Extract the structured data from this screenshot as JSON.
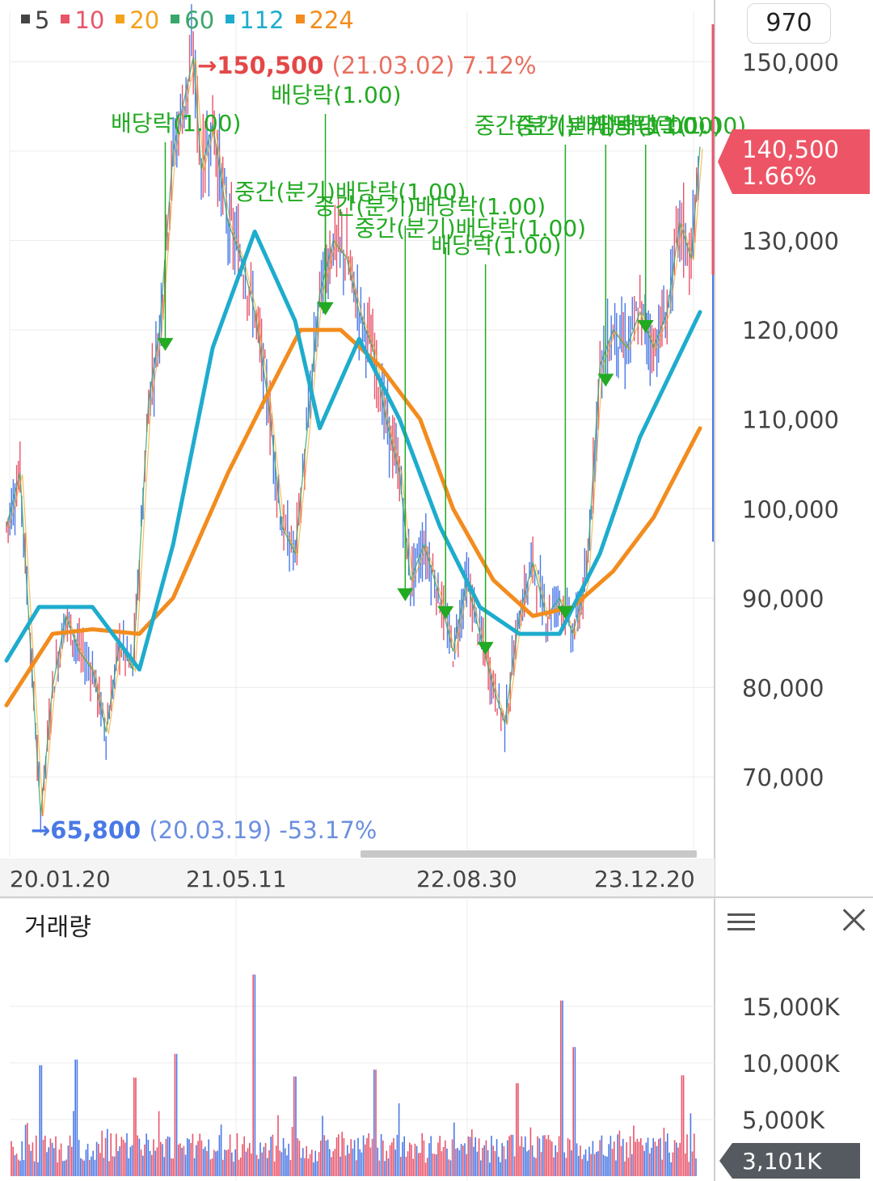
{
  "legend": [
    {
      "label": "5",
      "color": "#444444"
    },
    {
      "label": "10",
      "color": "#e8556b"
    },
    {
      "label": "20",
      "color": "#f4a21c"
    },
    {
      "label": "60",
      "color": "#3aa66a"
    },
    {
      "label": "112",
      "color": "#1eaccd"
    },
    {
      "label": "224",
      "color": "#f28c1e"
    }
  ],
  "ma_count": "970",
  "max_marker": {
    "price": "150,500",
    "detail": "(21.03.02) 7.12%"
  },
  "min_marker": {
    "price": "65,800",
    "detail": "(20.03.19) -53.17%"
  },
  "current": {
    "price": "140,500",
    "change": "1.66%"
  },
  "volume_title": "거래량",
  "volume_current": "3,101K",
  "colors": {
    "up": "#e8556b",
    "down": "#4a79e6",
    "ma112": "#1eaccd",
    "ma224": "#f28c1e",
    "ma60": "#3aa66a",
    "ma20": "#f4a21c",
    "annotation": "#22aa22",
    "current_bg": "#ed5566",
    "volume_badge": "#555a60"
  },
  "chart_data": [
    {
      "type": "line",
      "title": "",
      "yticks": [
        150000,
        140000,
        130000,
        120000,
        110000,
        100000,
        90000,
        80000,
        70000
      ],
      "ytick_labels": [
        "150,000",
        "140,500",
        "130,000",
        "120,000",
        "110,000",
        "100,000",
        "90,000",
        "80,000",
        "70,000"
      ],
      "ylim": [
        61500,
        156000
      ],
      "xticks": [
        "20.01.20",
        "21.05.11",
        "22.08.30",
        "23.12.20"
      ],
      "x_range": [
        "2020-01-01",
        "2024-04-30"
      ],
      "series": [
        {
          "name": "close",
          "points": [
            [
              "2020-01-01",
              98000
            ],
            [
              "2020-02-01",
              104000
            ],
            [
              "2020-03-19",
              65800
            ],
            [
              "2020-04-15",
              80000
            ],
            [
              "2020-05-15",
              88000
            ],
            [
              "2020-06-15",
              84000
            ],
            [
              "2020-07-15",
              82000
            ],
            [
              "2020-08-15",
              75000
            ],
            [
              "2020-09-15",
              85000
            ],
            [
              "2020-10-15",
              82000
            ],
            [
              "2020-10-30",
              94000
            ],
            [
              "2020-11-20",
              112000
            ],
            [
              "2020-12-15",
              120000
            ],
            [
              "2021-01-15",
              140000
            ],
            [
              "2021-03-02",
              150500
            ],
            [
              "2021-03-20",
              138000
            ],
            [
              "2021-04-15",
              143000
            ],
            [
              "2021-05-20",
              132000
            ],
            [
              "2021-06-20",
              128000
            ],
            [
              "2021-07-20",
              122000
            ],
            [
              "2021-08-20",
              112000
            ],
            [
              "2021-09-20",
              98000
            ],
            [
              "2021-10-20",
              95000
            ],
            [
              "2021-11-15",
              108000
            ],
            [
              "2021-12-15",
              124000
            ],
            [
              "2022-01-15",
              130000
            ],
            [
              "2022-02-15",
              128000
            ],
            [
              "2022-03-15",
              122000
            ],
            [
              "2022-04-15",
              118000
            ],
            [
              "2022-05-15",
              110000
            ],
            [
              "2022-06-15",
              104000
            ],
            [
              "2022-07-10",
              92000
            ],
            [
              "2022-08-10",
              96000
            ],
            [
              "2022-09-15",
              90000
            ],
            [
              "2022-10-15",
              84000
            ],
            [
              "2022-11-15",
              92000
            ],
            [
              "2022-12-15",
              86000
            ],
            [
              "2023-01-15",
              80000
            ],
            [
              "2023-02-10",
              76000
            ],
            [
              "2023-03-15",
              88000
            ],
            [
              "2023-04-15",
              94000
            ],
            [
              "2023-05-15",
              88000
            ],
            [
              "2023-06-15",
              90000
            ],
            [
              "2023-07-15",
              86000
            ],
            [
              "2023-08-15",
              92000
            ],
            [
              "2023-09-15",
              116000
            ],
            [
              "2023-10-15",
              120000
            ],
            [
              "2023-11-15",
              118000
            ],
            [
              "2023-12-15",
              122000
            ],
            [
              "2024-01-15",
              118000
            ],
            [
              "2024-02-15",
              122000
            ],
            [
              "2024-03-15",
              132000
            ],
            [
              "2024-04-10",
              128000
            ],
            [
              "2024-04-30",
              140500
            ]
          ]
        },
        {
          "name": "224",
          "points": [
            [
              "2020-01-01",
              78000
            ],
            [
              "2020-04-15",
              86000
            ],
            [
              "2020-07-15",
              86500
            ],
            [
              "2020-10-30",
              86000
            ],
            [
              "2021-01-15",
              90000
            ],
            [
              "2021-05-20",
              104000
            ],
            [
              "2021-08-20",
              113000
            ],
            [
              "2021-11-01",
              120000
            ],
            [
              "2022-02-01",
              120000
            ],
            [
              "2022-05-01",
              116000
            ],
            [
              "2022-08-01",
              110000
            ],
            [
              "2022-10-15",
              100000
            ],
            [
              "2023-01-15",
              92000
            ],
            [
              "2023-04-15",
              88000
            ],
            [
              "2023-07-15",
              89000
            ],
            [
              "2023-10-15",
              93000
            ],
            [
              "2024-01-15",
              99000
            ],
            [
              "2024-04-30",
              109000
            ]
          ]
        },
        {
          "name": "112",
          "points": [
            [
              "2020-01-01",
              83000
            ],
            [
              "2020-03-15",
              89000
            ],
            [
              "2020-07-15",
              89000
            ],
            [
              "2020-10-30",
              82000
            ],
            [
              "2021-01-15",
              96000
            ],
            [
              "2021-04-15",
              118000
            ],
            [
              "2021-07-20",
              131000
            ],
            [
              "2021-10-20",
              121000
            ],
            [
              "2021-12-15",
              109000
            ],
            [
              "2022-03-15",
              119000
            ],
            [
              "2022-06-15",
              110000
            ],
            [
              "2022-09-15",
              98000
            ],
            [
              "2022-12-15",
              89000
            ],
            [
              "2023-03-15",
              86000
            ],
            [
              "2023-06-15",
              86000
            ],
            [
              "2023-09-15",
              95000
            ],
            [
              "2023-12-15",
              108000
            ],
            [
              "2024-04-30",
              122000
            ]
          ]
        }
      ]
    },
    {
      "type": "bar",
      "title": "거래량",
      "yticks": [
        15000,
        10000,
        5000
      ],
      "ytick_labels": [
        "15,000K",
        "10,000K",
        "5,000K"
      ],
      "ylim": [
        0,
        20200
      ],
      "unit": "K",
      "peaks": [
        [
          "2020-03-20",
          9800
        ],
        [
          "2020-06-10",
          10300
        ],
        [
          "2020-10-20",
          8700
        ],
        [
          "2021-01-20",
          10800
        ],
        [
          "2021-07-20",
          17800
        ],
        [
          "2021-10-20",
          8800
        ],
        [
          "2022-04-20",
          9400
        ],
        [
          "2023-03-10",
          8200
        ],
        [
          "2023-06-20",
          15500
        ],
        [
          "2023-07-20",
          11400
        ],
        [
          "2024-03-20",
          8900
        ]
      ],
      "last": 3101
    }
  ],
  "annotations": [
    {
      "text": "배당락(1.00)",
      "date": "2020-12-28"
    },
    {
      "text": "배당락(1.00)",
      "date": "2021-12-28"
    },
    {
      "text": "중간(분기)배당락(1.00)",
      "date": "2021-12-28"
    },
    {
      "text": "중간(분기)배당락(1.00)",
      "date": "2022-06-28"
    },
    {
      "text": "중간(분기)배당락(1.00)",
      "date": "2022-09-28"
    },
    {
      "text": "배당락(1.00)",
      "date": "2022-12-28"
    },
    {
      "text": "중간(분기)배당락(1.00)",
      "date": "2023-06-28"
    },
    {
      "text": "중간(분기)배당락(1.00)",
      "date": "2023-09-28"
    },
    {
      "text": "배당락(1.00)",
      "date": "2023-12-28"
    }
  ]
}
